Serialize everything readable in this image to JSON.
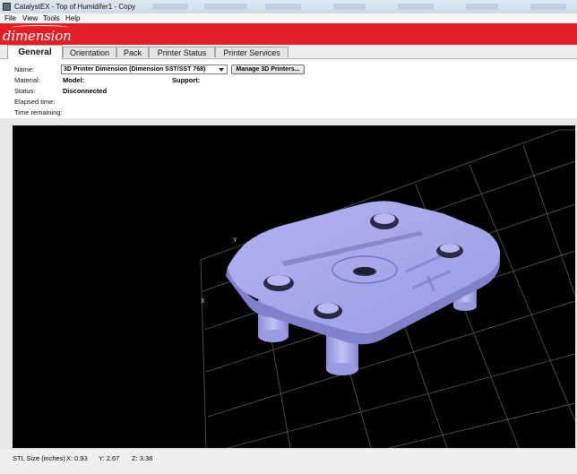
{
  "window": {
    "title": "CatalystEX - Top of Humidifer1 - Copy"
  },
  "menu": [
    "File",
    "View",
    "Tools",
    "Help"
  ],
  "brand": {
    "logo_text": "dimension",
    "color": "#e21f26"
  },
  "tabs": [
    "General",
    "Orientation",
    "Pack",
    "Printer Status",
    "Printer Services"
  ],
  "general": {
    "name_label": "Name:",
    "printer_selected": "3D Printer Dimension  (Dimension SST/SST 768)",
    "manage_button": "Manage 3D Printers...",
    "material_label": "Material:",
    "model_label": "Model:",
    "support_label": "Support:",
    "status_label": "Status:",
    "status_value": "Disconnected",
    "elapsed_label": "Elapsed time:",
    "remaining_label": "Time remaining:"
  },
  "viewport": {
    "axis_y": "Y",
    "axis_x": "X",
    "model_color": "#a8a8ec"
  },
  "status": {
    "size_label": "STL Size (inches)",
    "x": "X: 0.93",
    "y": "Y: 2.67",
    "z": "Z: 3.38"
  }
}
